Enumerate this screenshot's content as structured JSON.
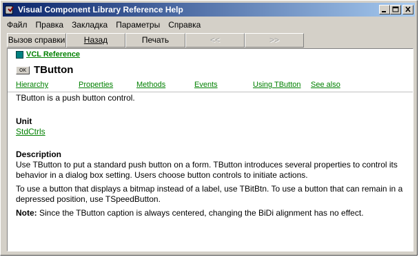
{
  "window": {
    "title": "Visual Component Library Reference Help"
  },
  "titlebar_buttons": {
    "minimize": "_",
    "maximize": "□",
    "close": "✕"
  },
  "menu": [
    "Файл",
    "Правка",
    "Закладка",
    "Параметры",
    "Справка"
  ],
  "toolbar": {
    "contents": "Вызов справки",
    "back": "Назад",
    "print": "Печать",
    "prev": "<<",
    "next": ">>"
  },
  "header": {
    "breadcrumb": "VCL Reference",
    "icon_label": "OK",
    "title": "TButton"
  },
  "nav_links": [
    "Hierarchy",
    "Properties",
    "Methods",
    "Events",
    "Using TButton",
    "See also"
  ],
  "body": {
    "summary": "TButton is a push button control.",
    "unit_heading": "Unit",
    "unit_link": "StdCtrls",
    "description_heading": "Description",
    "description_p1": "Use TButton to put a standard push button on a form. TButton introduces several properties to control its behavior in a dialog box setting. Users choose button controls to initiate actions.",
    "description_p2": "To use a button that displays a bitmap instead of a label, use TBitBtn. To use a button that can remain in a depressed position, use TSpeedButton.",
    "note_label": "Note:",
    "note_text": "Since the TButton caption is always centered, changing the BiDi alignment has no effect."
  },
  "colors": {
    "title_gradient_start": "#0a246a",
    "title_gradient_end": "#a6caf0",
    "link": "#008000",
    "chrome": "#d4d0c8"
  }
}
